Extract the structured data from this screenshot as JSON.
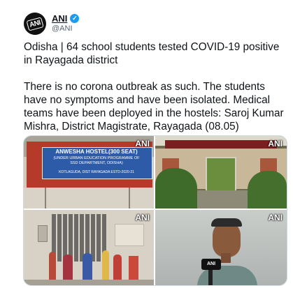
{
  "author": {
    "avatar_text": "ANI",
    "display_name": "ANI",
    "verified_mark": "✓",
    "handle": "@ANI"
  },
  "tweet": {
    "text": "Odisha | 64 school students tested COVID-19 positive in Rayagada district\n\nThere is no corona outbreak as such. The students have no symptoms and have been isolated. Medical teams have been deployed in the hostels: Saroj Kumar Mishra, District Magistrate, Rayagada (08.05)"
  },
  "media": {
    "watermark": "ANI",
    "sign_lines": [
      "ANWESHA HOSTEL(300 SEAT)",
      "(UNDER URBAN EDUCATION PROGRAMME OF",
      "SSD DEPARTMENT, ODISHA)",
      "KOTLAGUDA, DIST RAYAGADA ESTD-2020-21"
    ],
    "colors": {
      "hostel_red": "#b63a2a",
      "sign_blue": "#2d5ba8",
      "verified_blue": "#1d9bf0"
    }
  }
}
